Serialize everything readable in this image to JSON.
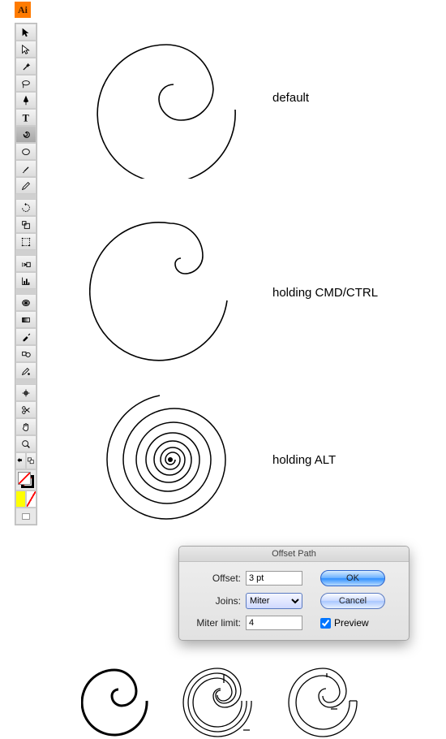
{
  "app": {
    "logo_text": "Ai"
  },
  "labels": {
    "default": "default",
    "cmd_ctrl": "holding CMD/CTRL",
    "alt": "holding ALT"
  },
  "dialog": {
    "title": "Offset Path",
    "offset_label": "Offset:",
    "offset_value": "3 pt",
    "joins_label": "Joins:",
    "joins_value": "Miter",
    "miter_label": "Miter limit:",
    "miter_value": "4",
    "ok": "OK",
    "cancel": "Cancel",
    "preview": "Preview"
  }
}
